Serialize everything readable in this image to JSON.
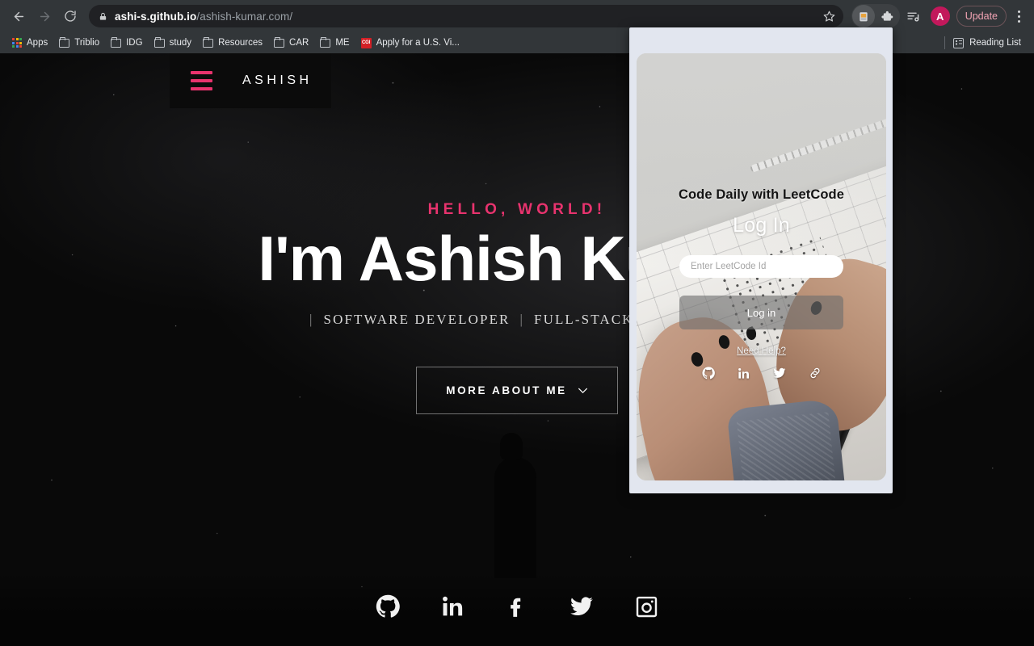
{
  "browser": {
    "nav": {
      "back": "back-arrow",
      "forward": "forward-arrow",
      "reload": "reload"
    },
    "omnibox": {
      "lock_icon": "lock-icon",
      "url_host": "ashi-s.github.io",
      "url_path": "/ashish-kumar.com/",
      "star_icon": "bookmark-star-icon"
    },
    "toolbar_right": {
      "extension_active_icon": "puzzle-extension-active-icon",
      "extensions_icon": "puzzle-icon",
      "reading_list_icon": "reading-list-icon",
      "profile_initial": "A",
      "update_label": "Update",
      "menu_icon": "three-dots-menu-icon"
    },
    "bookmarks": [
      {
        "label": "Apps",
        "icon": "apps-grid-icon"
      },
      {
        "label": "Triblio",
        "icon": "folder-icon"
      },
      {
        "label": "IDG",
        "icon": "folder-icon"
      },
      {
        "label": "study",
        "icon": "folder-icon"
      },
      {
        "label": "Resources",
        "icon": "folder-icon"
      },
      {
        "label": "CAR",
        "icon": "folder-icon"
      },
      {
        "label": "ME",
        "icon": "folder-icon"
      },
      {
        "label": "Apply for a U.S. Vi...",
        "icon": "cgi-favicon"
      }
    ],
    "reading_list_label": "Reading List"
  },
  "site": {
    "header": {
      "menu_icon": "hamburger-menu-icon",
      "brand": "ASHISH"
    },
    "hero": {
      "eyebrow": "HELLO, WORLD!",
      "title": "I'm Ashish Kumar",
      "subtitle_parts": [
        "SOFTWARE DEVELOPER",
        "FULL-STACK DEVELOPER"
      ],
      "cta_label": "MORE ABOUT ME",
      "cta_icon": "chevron-down-icon"
    },
    "socials": [
      {
        "name": "github",
        "label": "GitHub"
      },
      {
        "name": "linkedin",
        "label": "LinkedIn"
      },
      {
        "name": "facebook",
        "label": "Facebook"
      },
      {
        "name": "twitter",
        "label": "Twitter"
      },
      {
        "name": "instagram",
        "label": "Instagram"
      }
    ]
  },
  "popup": {
    "heading": "Code Daily with LeetCode",
    "login_title": "Log In",
    "input_placeholder": "Enter LeetCode Id",
    "input_value": "",
    "login_button_label": "Log in",
    "help_link_label": "Need Help?",
    "socials": [
      {
        "name": "github",
        "label": "GitHub"
      },
      {
        "name": "linkedin",
        "label": "LinkedIn"
      },
      {
        "name": "twitter",
        "label": "Twitter"
      },
      {
        "name": "link",
        "label": "Link"
      }
    ]
  },
  "colors": {
    "chrome_bg": "#323639",
    "omnibox_bg": "#202124",
    "accent_pink": "#e8336e",
    "profile_pink": "#c2185b",
    "update_text": "#f2a4b4",
    "page_bg": "#090909",
    "popup_bg": "#e2e6ef",
    "cgi_red": "#d32026"
  }
}
